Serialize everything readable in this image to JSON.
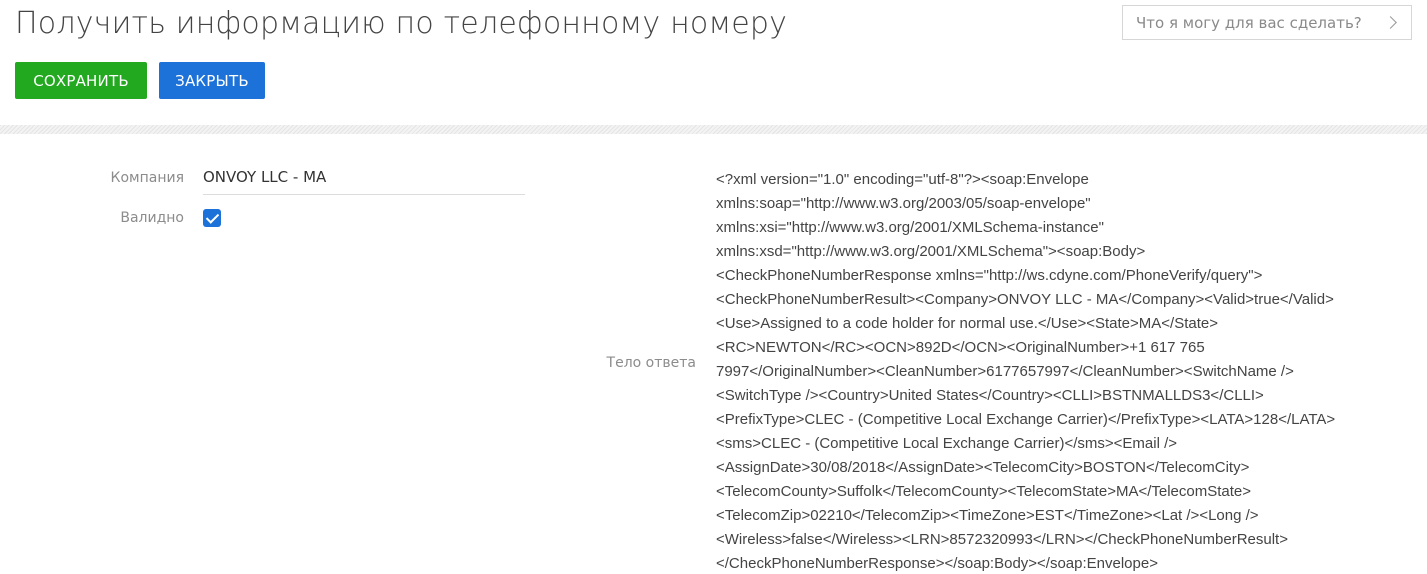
{
  "header": {
    "title": "Получить информацию по телефонному номеру",
    "assistant_placeholder": "Что я могу для вас сделать?",
    "assistant_icon": "chevron-right-icon"
  },
  "toolbar": {
    "save_label": "СОХРАНИТЬ",
    "close_label": "ЗАКРЫТЬ"
  },
  "colors": {
    "save": "#22a91f",
    "close": "#1d72d9",
    "checkbox": "#1d72d9"
  },
  "form": {
    "company_label": "Компания",
    "company_value": "ONVOY LLC - MA",
    "valid_label": "Валидно",
    "valid_checked": true,
    "body_label": "Тело ответа",
    "response_lines": [
      "<?xml version=\"1.0\" encoding=\"utf-8\"?><soap:Envelope",
      "xmlns:soap=\"http://www.w3.org/2003/05/soap-envelope\"",
      "xmlns:xsi=\"http://www.w3.org/2001/XMLSchema-instance\"",
      "xmlns:xsd=\"http://www.w3.org/2001/XMLSchema\"><soap:Body>",
      "<CheckPhoneNumberResponse xmlns=\"http://ws.cdyne.com/PhoneVerify/query\">",
      "<CheckPhoneNumberResult><Company>ONVOY LLC - MA</Company><Valid>true</Valid>",
      "<Use>Assigned to a code holder for normal use.</Use><State>MA</State>",
      "<RC>NEWTON</RC><OCN>892D</OCN><OriginalNumber>+1 617 765",
      "7997</OriginalNumber><CleanNumber>6177657997</CleanNumber><SwitchName />",
      "<SwitchType /><Country>United States</Country><CLLI>BSTNMALLDS3</CLLI>",
      "<PrefixType>CLEC - (Competitive Local Exchange Carrier)</PrefixType><LATA>128</LATA>",
      "<sms>CLEC - (Competitive Local Exchange Carrier)</sms><Email />",
      "<AssignDate>30/08/2018</AssignDate><TelecomCity>BOSTON</TelecomCity>",
      "<TelecomCounty>Suffolk</TelecomCounty><TelecomState>MA</TelecomState>",
      "<TelecomZip>02210</TelecomZip><TimeZone>EST</TimeZone><Lat /><Long />",
      "<Wireless>false</Wireless><LRN>8572320993</LRN></CheckPhoneNumberResult>",
      "</CheckPhoneNumberResponse></soap:Body></soap:Envelope>"
    ]
  }
}
